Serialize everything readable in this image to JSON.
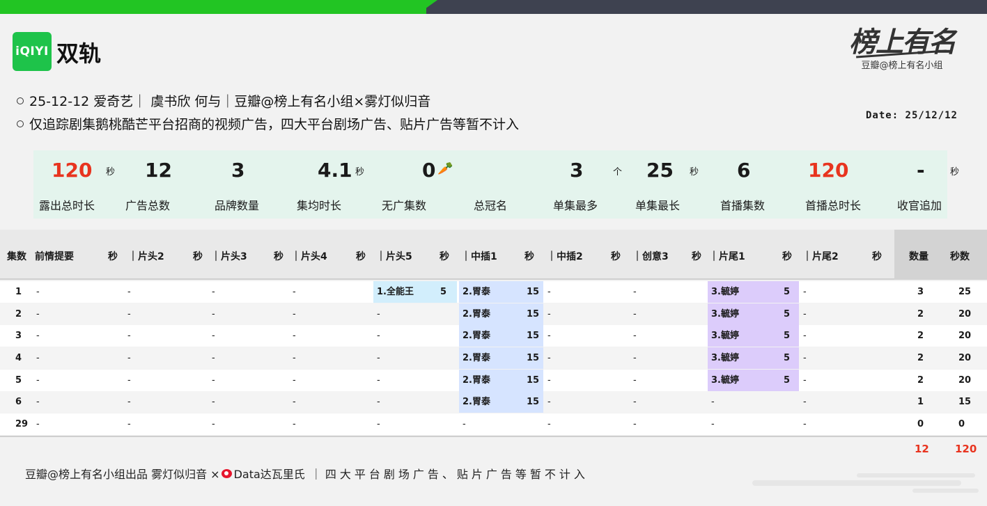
{
  "header": {
    "logo_text": "iQIYI",
    "title": "双轨",
    "brand_calligraphy": "榜上有名",
    "brand_subtitle": "豆瓣@榜上有名小组",
    "info_line1": "25-12-12 爱奇艺｜ 虞书欣 何与｜豆瓣@榜上有名小组×雾灯似归音",
    "info_line2": "仅追踪剧集鹅桃酷芒平台招商的视频广告，四大平台剧场广告、贴片广告等暂不计入",
    "date": "Date: 25/12/12"
  },
  "stats": [
    {
      "value": "120",
      "unit": "秒",
      "label": "露出总时长",
      "red": true
    },
    {
      "value": "12",
      "unit": "",
      "label": "广告总数",
      "red": false
    },
    {
      "value": "3",
      "unit": "",
      "label": "品牌数量",
      "red": false
    },
    {
      "value": "4.1",
      "unit": "秒",
      "label": "集均时长",
      "red": false
    },
    {
      "value": "0",
      "unit": "",
      "label": "无广集数",
      "red": false
    },
    {
      "value": "",
      "unit": "",
      "label": "总冠名",
      "red": false
    },
    {
      "value": "3",
      "unit": "个",
      "label": "单集最多",
      "red": false
    },
    {
      "value": "25",
      "unit": "秒",
      "label": "单集最长",
      "red": false
    },
    {
      "value": "6",
      "unit": "",
      "label": "首播集数",
      "red": false
    },
    {
      "value": "120",
      "unit": "",
      "label": "首播总时长",
      "red": true
    },
    {
      "value": "-",
      "unit": "秒",
      "label": "收官追加",
      "red": false
    }
  ],
  "table": {
    "headers": [
      "集数",
      "前情提要",
      "秒",
      "｜片头2",
      "秒",
      "｜片头3",
      "秒",
      "｜片头4",
      "秒",
      "｜片头5",
      "秒",
      "｜中插1",
      "秒",
      "｜中插2",
      "秒",
      "｜创意3",
      "秒",
      "｜片尾1",
      "秒",
      "｜片尾2",
      "秒",
      "数量",
      "秒数"
    ],
    "rows": [
      {
        "ep": "1",
        "c": [
          "-",
          "-",
          "-",
          "-",
          "1.全能王",
          "2.胃泰",
          "-",
          "-",
          "3.毓婷",
          "-"
        ],
        "s": [
          "",
          "",
          "",
          "",
          "5",
          "15",
          "",
          "",
          "5",
          ""
        ],
        "count": "3",
        "secs": "25"
      },
      {
        "ep": "2",
        "c": [
          "-",
          "-",
          "-",
          "-",
          "-",
          "2.胃泰",
          "-",
          "-",
          "3.毓婷",
          "-"
        ],
        "s": [
          "",
          "",
          "",
          "",
          "",
          "15",
          "",
          "",
          "5",
          ""
        ],
        "count": "2",
        "secs": "20"
      },
      {
        "ep": "3",
        "c": [
          "-",
          "-",
          "-",
          "-",
          "-",
          "2.胃泰",
          "-",
          "-",
          "3.毓婷",
          "-"
        ],
        "s": [
          "",
          "",
          "",
          "",
          "",
          "15",
          "",
          "",
          "5",
          ""
        ],
        "count": "2",
        "secs": "20"
      },
      {
        "ep": "4",
        "c": [
          "-",
          "-",
          "-",
          "-",
          "-",
          "2.胃泰",
          "-",
          "-",
          "3.毓婷",
          "-"
        ],
        "s": [
          "",
          "",
          "",
          "",
          "",
          "15",
          "",
          "",
          "5",
          ""
        ],
        "count": "2",
        "secs": "20"
      },
      {
        "ep": "5",
        "c": [
          "-",
          "-",
          "-",
          "-",
          "-",
          "2.胃泰",
          "-",
          "-",
          "3.毓婷",
          "-"
        ],
        "s": [
          "",
          "",
          "",
          "",
          "",
          "15",
          "",
          "",
          "5",
          ""
        ],
        "count": "2",
        "secs": "20"
      },
      {
        "ep": "6",
        "c": [
          "-",
          "-",
          "-",
          "-",
          "-",
          "2.胃泰",
          "-",
          "-",
          "-",
          "-"
        ],
        "s": [
          "",
          "",
          "",
          "",
          "",
          "15",
          "",
          "",
          "",
          ""
        ],
        "count": "1",
        "secs": "15"
      },
      {
        "ep": "29",
        "c": [
          "-",
          "-",
          "-",
          "-",
          "-",
          "-",
          "-",
          "-",
          "-",
          "-"
        ],
        "s": [
          "",
          "",
          "",
          "",
          "",
          "",
          "",
          "",
          "",
          ""
        ],
        "count": "0",
        "secs": "0"
      }
    ],
    "total_count": "12",
    "total_secs": "120"
  },
  "footer": {
    "credit": "豆瓣@榜上有名小组出品  雾灯似归音 ×",
    "source": "Data达瓦里氏",
    "note": "｜四大平台剧场广告、贴片广告等暂不计入"
  },
  "colors": {
    "accent_green": "#22c523",
    "dark_bar": "#3e4250",
    "red": "#e8341f",
    "cyan": "#d2eefc",
    "blue": "#d6e4ff",
    "purple": "#dcccfb"
  }
}
